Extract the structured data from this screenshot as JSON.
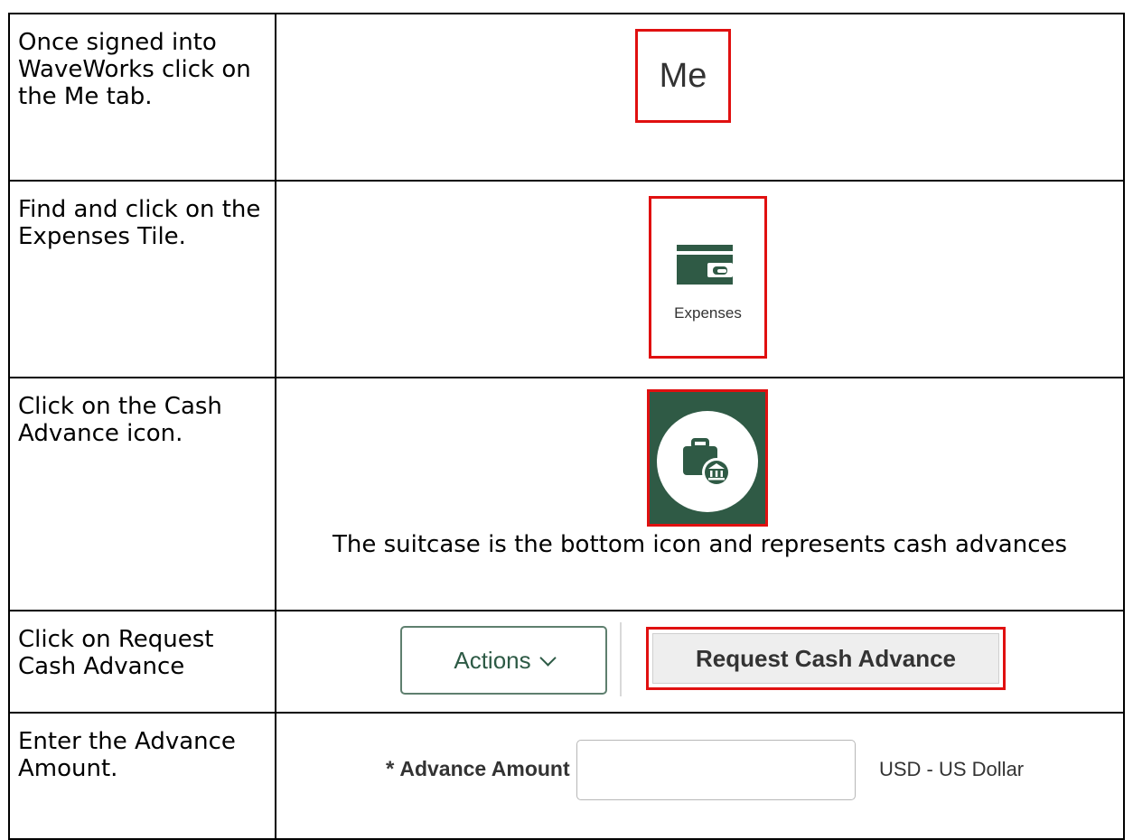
{
  "steps": [
    {
      "instruction": "Once signed into WaveWorks click on the Me tab.",
      "tab_label": "Me"
    },
    {
      "instruction": "Find and click on the Expenses Tile.",
      "tile_label": "Expenses",
      "icon": "wallet-icon"
    },
    {
      "instruction": "Click on the Cash Advance icon.",
      "caption": "The suitcase is the bottom icon and represents cash advances",
      "icon": "suitcase-bank-icon"
    },
    {
      "instruction": "Click on Request Cash Advance",
      "actions_label": "Actions",
      "request_label": "Request Cash Advance"
    },
    {
      "instruction": "Enter the Advance Amount.",
      "field_label": "Advance Amount",
      "required_mark": "*",
      "currency": "USD - US Dollar"
    }
  ],
  "colors": {
    "highlight": "#e01010",
    "brand_green": "#2f5a45",
    "text": "#000000"
  }
}
